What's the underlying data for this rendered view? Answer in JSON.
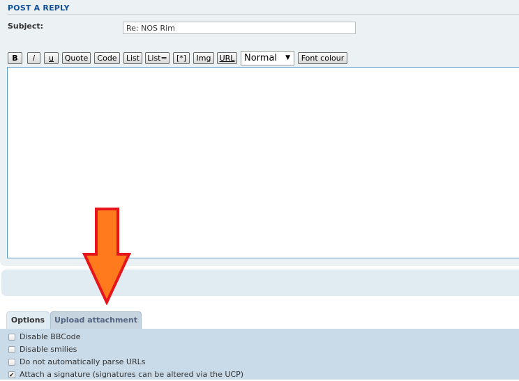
{
  "heading": "POST A REPLY",
  "subject": {
    "label": "Subject:",
    "value": "Re: NOS Rim"
  },
  "toolbar": {
    "bold": "B",
    "italic": "i",
    "underline": "u",
    "quote": "Quote",
    "code": "Code",
    "list": "List",
    "list_eq": "List=",
    "list_item": "[*]",
    "img": "Img",
    "url": "URL",
    "font_size": "Normal",
    "font_colour": "Font colour"
  },
  "tabs": {
    "options": "Options",
    "upload": "Upload attachment"
  },
  "options": [
    {
      "label": "Disable BBCode",
      "checked": false
    },
    {
      "label": "Disable smilies",
      "checked": false
    },
    {
      "label": "Do not automatically parse URLs",
      "checked": false
    },
    {
      "label": "Attach a signature (signatures can be altered via the UCP)",
      "checked": true
    }
  ],
  "colors": {
    "heading": "#115098",
    "arrow_fill": "#FF7A1C",
    "arrow_stroke": "#E8141B",
    "editor_border": "#5c9ccc"
  }
}
